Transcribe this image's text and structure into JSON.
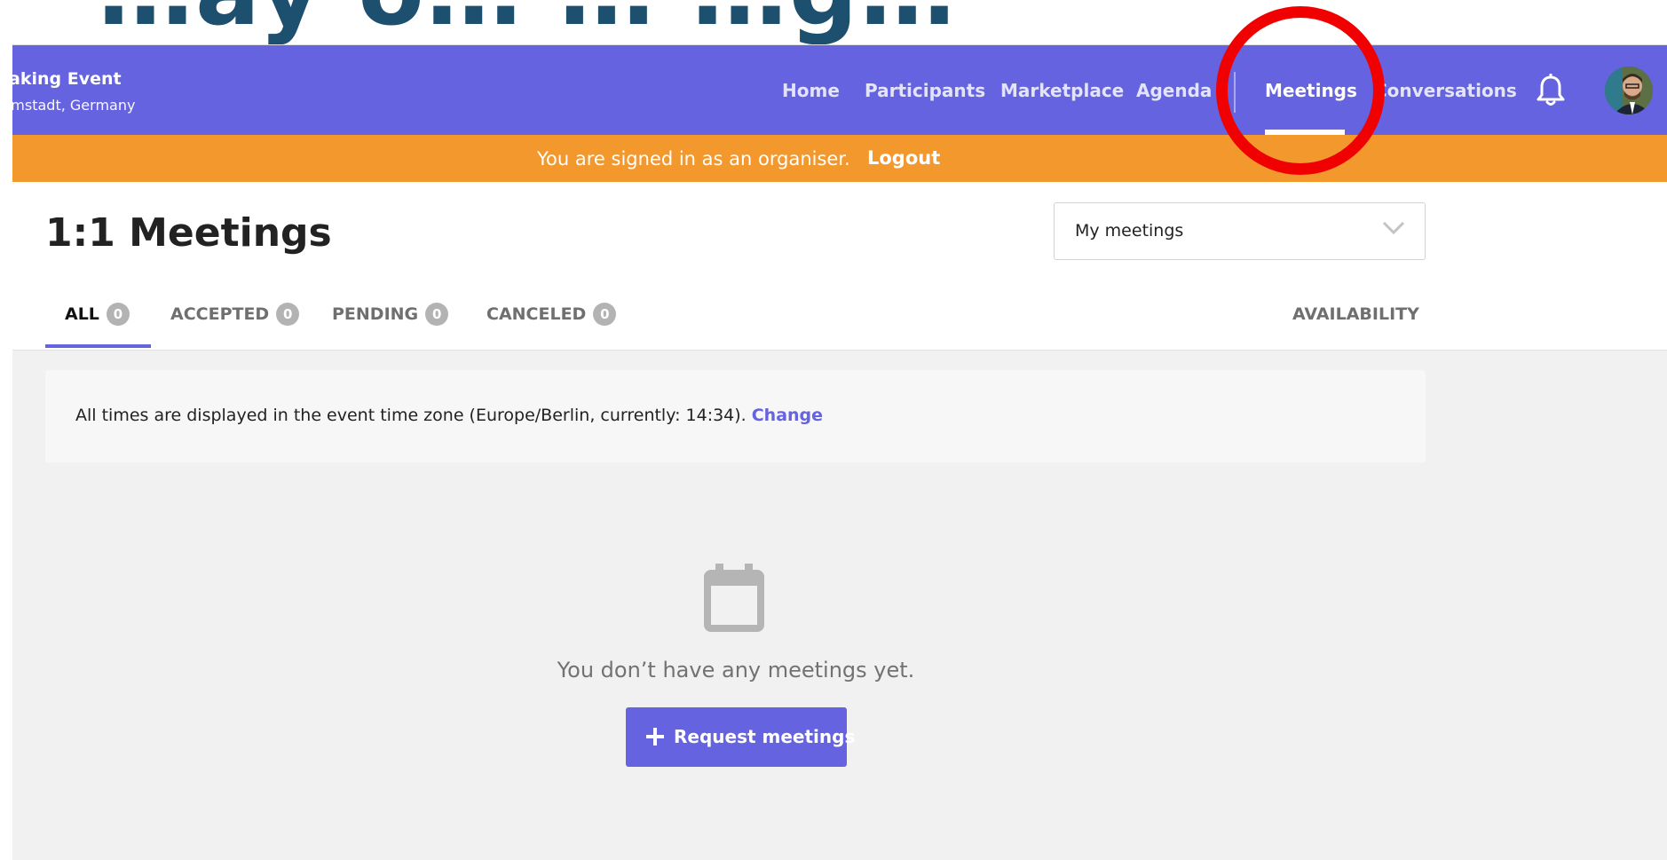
{
  "page_heading_fragment": "…ay o… … …g…",
  "event": {
    "name": "aking Event",
    "location": "rmstadt, Germany"
  },
  "nav": {
    "items": [
      {
        "label": "Home"
      },
      {
        "label": "Participants"
      },
      {
        "label": "Marketplace"
      },
      {
        "label": "Agenda"
      },
      {
        "label": "Meetings"
      },
      {
        "label": "Conversations"
      }
    ],
    "active_item": "Meetings"
  },
  "organiser_bar": {
    "message": "You are signed in as an organiser.",
    "logout_label": "Logout"
  },
  "header": {
    "title": "1:1 Meetings",
    "filter_select": {
      "value": "My meetings"
    },
    "tabs": [
      {
        "label": "ALL",
        "count": "0"
      },
      {
        "label": "ACCEPTED",
        "count": "0"
      },
      {
        "label": "PENDING",
        "count": "0"
      },
      {
        "label": "CANCELED",
        "count": "0"
      }
    ],
    "active_tab": "ALL",
    "availability_label": "AVAILABILITY"
  },
  "timezone_notice": {
    "text": "All times are displayed in the event time zone (Europe/Berlin, currently: 14:34).",
    "change_label": "Change"
  },
  "empty_state": {
    "icon": "calendar-icon",
    "message": "You don’t have any meetings yet.",
    "button_label": "Request meetings",
    "button_icon": "plus-icon"
  },
  "colors": {
    "primary": "#6563e0",
    "organiser_bar": "#f2982d",
    "annotation": "#f00000",
    "background": "#f1f1f1",
    "heading_fragment": "#1d4f6e"
  }
}
